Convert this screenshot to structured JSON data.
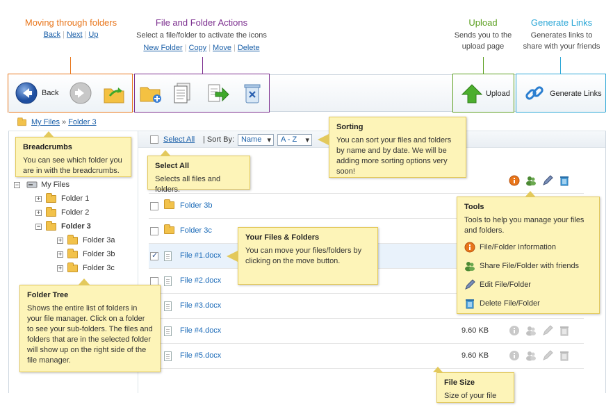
{
  "headers": {
    "moving": {
      "title": "Moving through folders",
      "links": [
        "Back",
        "Next",
        "Up"
      ],
      "color": "#e8751a"
    },
    "actions": {
      "title": "File and Folder Actions",
      "desc": "Select a file/folder to activate the icons",
      "links": [
        "New Folder",
        "Copy",
        "Move",
        "Delete"
      ],
      "color": "#7b2d8e"
    },
    "upload": {
      "title": "Upload",
      "desc1": "Sends you to the",
      "desc2": "upload page",
      "color": "#5a9e1e"
    },
    "links": {
      "title": "Generate Links",
      "desc1": "Generates links to",
      "desc2": "share with your friends",
      "color": "#2aa6d6"
    }
  },
  "toolbar": {
    "back": "Back",
    "upload": "Upload",
    "generate": "Generate Links"
  },
  "breadcrumb": {
    "root": "My Files",
    "sep": "»",
    "current": "Folder 3"
  },
  "sortbar": {
    "select_all": "Select All",
    "sort_by": "| Sort By:",
    "sort_field": "Name",
    "sort_order": "A - Z"
  },
  "tree": {
    "root": "My Files",
    "items": [
      "Folder 1",
      "Folder 2",
      "Folder 3",
      "Folder 3a",
      "Folder 3b",
      "Folder 3c"
    ]
  },
  "files": [
    {
      "name": "Folder 3b",
      "type": "folder",
      "size": ""
    },
    {
      "name": "Folder 3c",
      "type": "folder",
      "size": ""
    },
    {
      "name": "File #1.docx",
      "type": "file",
      "size": "",
      "checked": true
    },
    {
      "name": "File #2.docx",
      "type": "file",
      "size": ""
    },
    {
      "name": "File #3.docx",
      "type": "file",
      "size": ""
    },
    {
      "name": "File #4.docx",
      "type": "file",
      "size": "9.60 KB"
    },
    {
      "name": "File #5.docx",
      "type": "file",
      "size": "9.60 KB"
    }
  ],
  "notes": {
    "breadcrumbs": {
      "title": "Breadcrumbs",
      "body": "You can see which folder you are in with the breadcrumbs."
    },
    "select_all": {
      "title": "Select All",
      "body": "Selects all files and folders."
    },
    "sorting": {
      "title": "Sorting",
      "body": "You can sort your files and folders by name and by date. We will be adding more sorting options very soon!"
    },
    "files": {
      "title": "Your Files & Folders",
      "body": "You can move your files/folders by clicking on the move button."
    },
    "tree": {
      "title": "Folder Tree",
      "body": "Shows the entire list of folders in your file manager. Click on a folder to see your sub-folders. The files and folders that are in the selected folder will show up on the right side of the file manager."
    },
    "tools": {
      "title": "Tools",
      "body": "Tools to help you manage your files and folders.",
      "items": [
        "File/Folder Information",
        "Share File/Folder with friends",
        "Edit File/Folder",
        "Delete File/Folder"
      ]
    },
    "filesize": {
      "title": "File Size",
      "body": "Size of your file"
    }
  },
  "icons": [
    "back-arrow-icon",
    "forward-arrow-icon",
    "up-folder-icon",
    "new-folder-icon",
    "copy-icon",
    "move-icon",
    "delete-icon",
    "upload-icon",
    "link-icon",
    "info-icon",
    "share-icon",
    "edit-icon",
    "trash-icon"
  ]
}
